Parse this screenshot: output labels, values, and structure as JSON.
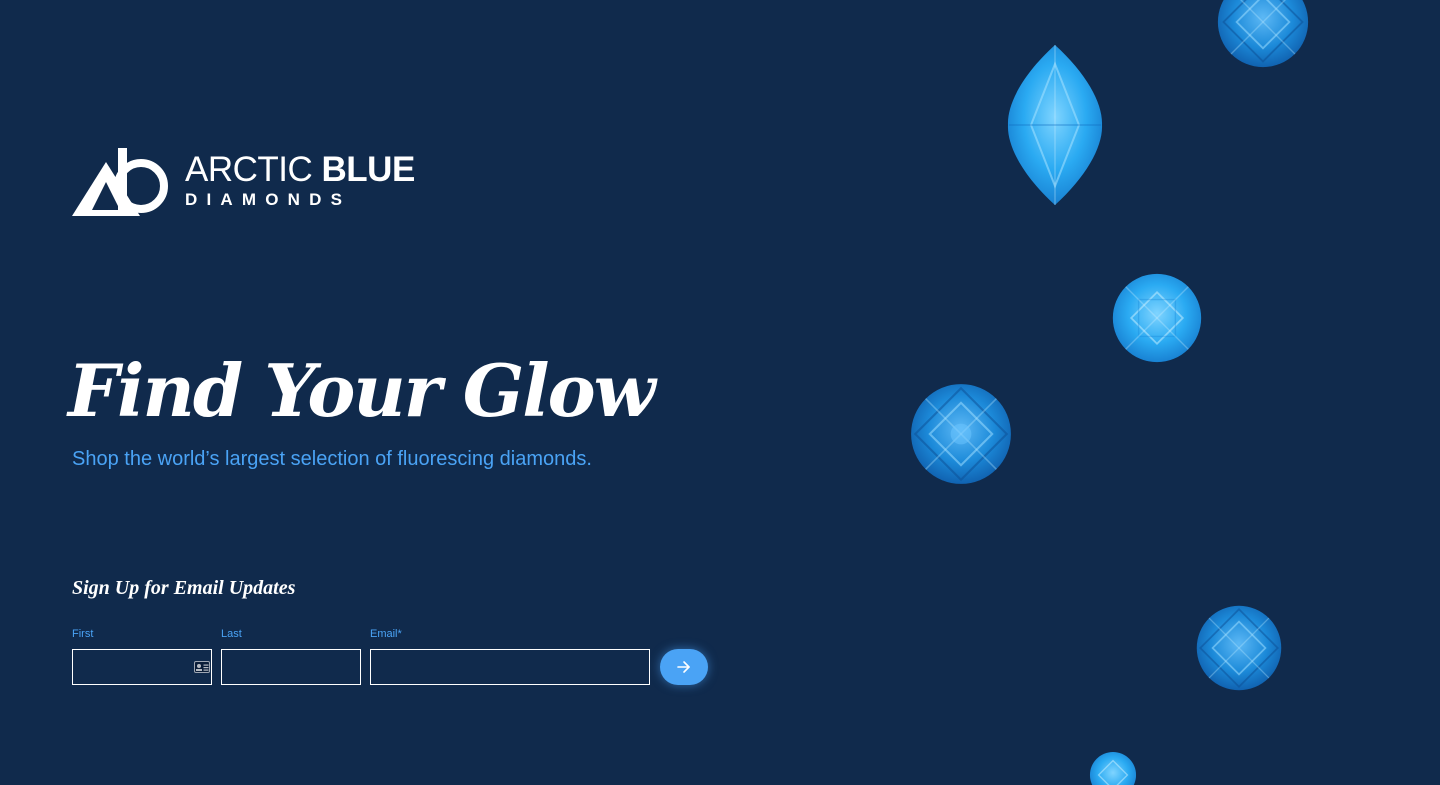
{
  "brand": {
    "name_light": "ARCTIC",
    "name_bold": "BLUE",
    "name_sub": "DIAMONDS",
    "logo_icon": "triangle-ab-monogram-icon"
  },
  "hero": {
    "headline": "Find Your Glow",
    "subhead": "Shop the world’s largest selection of fluorescing diamonds."
  },
  "signup": {
    "title": "Sign Up for Email Updates",
    "first_label": "First",
    "last_label": "Last",
    "email_label": "Email*",
    "first_value": "",
    "last_value": "",
    "email_value": "",
    "submit_icon": "arrow-right-icon",
    "autofill_icon": "contact-card-icon"
  },
  "colors": {
    "background": "#102a4c",
    "accent": "#4aa3f5",
    "text": "#ffffff"
  },
  "decor": {
    "gems": [
      "round",
      "marquise",
      "round",
      "round",
      "round",
      "round"
    ]
  }
}
